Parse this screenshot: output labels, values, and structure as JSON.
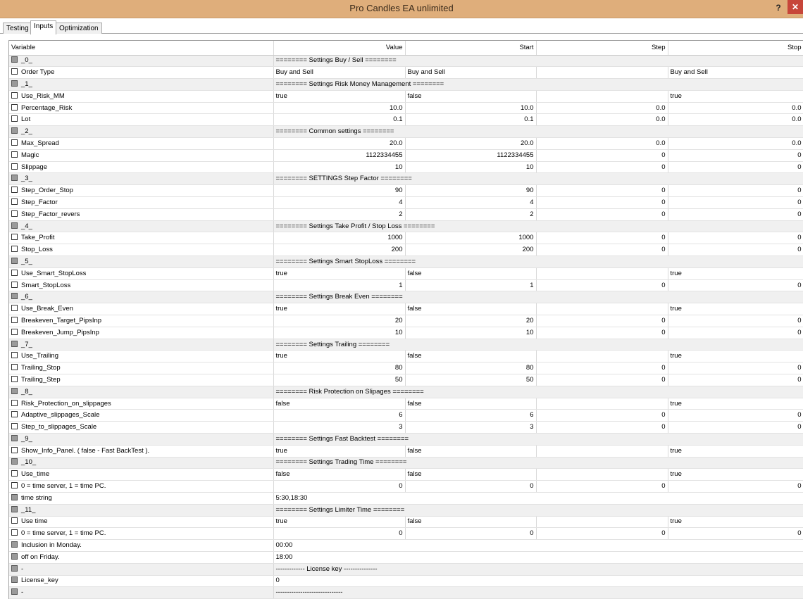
{
  "window": {
    "title": "Pro Candles EA unlimited",
    "help": "?",
    "close": "✕"
  },
  "tabs": [
    "Testing",
    "Inputs",
    "Optimization"
  ],
  "active_tab": "Inputs",
  "columns": [
    "Variable",
    "Value",
    "Start",
    "Step",
    "Stop"
  ],
  "rows": [
    {
      "kind": "group",
      "name": "_0_",
      "value": "======== Settings Buy / Sell ========"
    },
    {
      "kind": "row",
      "name": "Order Type",
      "value": "Buy and Sell",
      "start": "Buy and Sell",
      "step": "",
      "stop": "Buy and Sell",
      "text": true
    },
    {
      "kind": "group",
      "name": "_1_",
      "value": "======== Settings Risk Money Management ========"
    },
    {
      "kind": "row",
      "name": "Use_Risk_MM",
      "value": "true",
      "start": "false",
      "step": "",
      "stop": "true",
      "text": true
    },
    {
      "kind": "row",
      "name": "Percentage_Risk",
      "value": "10.0",
      "start": "10.0",
      "step": "0.0",
      "stop": "0.0"
    },
    {
      "kind": "row",
      "name": "Lot",
      "value": "0.1",
      "start": "0.1",
      "step": "0.0",
      "stop": "0.0"
    },
    {
      "kind": "group",
      "name": "_2_",
      "value": "======== Common settings ========"
    },
    {
      "kind": "row",
      "name": "Max_Spread",
      "value": "20.0",
      "start": "20.0",
      "step": "0.0",
      "stop": "0.0"
    },
    {
      "kind": "row",
      "name": "Magic",
      "value": "1122334455",
      "start": "1122334455",
      "step": "0",
      "stop": "0"
    },
    {
      "kind": "row",
      "name": "Slippage",
      "value": "10",
      "start": "10",
      "step": "0",
      "stop": "0"
    },
    {
      "kind": "group",
      "name": "_3_",
      "value": "======== SETTINGS Step Factor ========"
    },
    {
      "kind": "row",
      "name": "Step_Order_Stop",
      "value": "90",
      "start": "90",
      "step": "0",
      "stop": "0"
    },
    {
      "kind": "row",
      "name": "Step_Factor",
      "value": "4",
      "start": "4",
      "step": "0",
      "stop": "0"
    },
    {
      "kind": "row",
      "name": "Step_Factor_revers",
      "value": "2",
      "start": "2",
      "step": "0",
      "stop": "0"
    },
    {
      "kind": "group",
      "name": "_4_",
      "value": "======== Settings Take Profit / Stop Loss ========"
    },
    {
      "kind": "row",
      "name": "Take_Profit",
      "value": "1000",
      "start": "1000",
      "step": "0",
      "stop": "0"
    },
    {
      "kind": "row",
      "name": "Stop_Loss",
      "value": "200",
      "start": "200",
      "step": "0",
      "stop": "0"
    },
    {
      "kind": "group",
      "name": "_5_",
      "value": "======== Settings Smart StopLoss ========"
    },
    {
      "kind": "row",
      "name": "Use_Smart_StopLoss",
      "value": "true",
      "start": "false",
      "step": "",
      "stop": "true",
      "text": true
    },
    {
      "kind": "row",
      "name": "Smart_StopLoss",
      "value": "1",
      "start": "1",
      "step": "0",
      "stop": "0"
    },
    {
      "kind": "group",
      "name": "_6_",
      "value": "======== Settings Break Even  ========"
    },
    {
      "kind": "row",
      "name": "Use_Break_Even",
      "value": "true",
      "start": "false",
      "step": "",
      "stop": "true",
      "text": true
    },
    {
      "kind": "row",
      "name": "Breakeven_Target_PipsInp",
      "value": "20",
      "start": "20",
      "step": "0",
      "stop": "0"
    },
    {
      "kind": "row",
      "name": "Breakeven_Jump_PipsInp",
      "value": "10",
      "start": "10",
      "step": "0",
      "stop": "0"
    },
    {
      "kind": "group",
      "name": "_7_",
      "value": "======== Settings Trailing  ========"
    },
    {
      "kind": "row",
      "name": "Use_Trailing",
      "value": "true",
      "start": "false",
      "step": "",
      "stop": "true",
      "text": true
    },
    {
      "kind": "row",
      "name": "Trailing_Stop",
      "value": "80",
      "start": "80",
      "step": "0",
      "stop": "0"
    },
    {
      "kind": "row",
      "name": "Trailing_Step",
      "value": "50",
      "start": "50",
      "step": "0",
      "stop": "0"
    },
    {
      "kind": "group",
      "name": "_8_",
      "value": "======== Risk Protection on Slipages ========"
    },
    {
      "kind": "row",
      "name": "Risk_Protection_on_slippages",
      "value": "false",
      "start": "false",
      "step": "",
      "stop": "true",
      "text": true
    },
    {
      "kind": "row",
      "name": "Adaptive_slippages_Scale",
      "value": "6",
      "start": "6",
      "step": "0",
      "stop": "0"
    },
    {
      "kind": "row",
      "name": "Step_to_slippages_Scale",
      "value": "3",
      "start": "3",
      "step": "0",
      "stop": "0"
    },
    {
      "kind": "group",
      "name": "_9_",
      "value": "======== Settings Fast Backtest ========"
    },
    {
      "kind": "row",
      "name": "Show_Info_Panel. ( false - Fast BackTest ).",
      "value": "true",
      "start": "false",
      "step": "",
      "stop": "true",
      "text": true
    },
    {
      "kind": "group",
      "name": "_10_",
      "value": "======== Settings Trading Time ========"
    },
    {
      "kind": "row",
      "name": "Use_time",
      "value": "false",
      "start": "false",
      "step": "",
      "stop": "true",
      "text": true
    },
    {
      "kind": "row",
      "name": "0 = time server, 1 = time PC.",
      "value": "0",
      "start": "0",
      "step": "0",
      "stop": "0"
    },
    {
      "kind": "plain",
      "name": "time string",
      "value": "5:30,18:30"
    },
    {
      "kind": "group",
      "name": "_11_",
      "value": "======== Settings Limiter Time ========"
    },
    {
      "kind": "row",
      "name": "Use time",
      "value": "true",
      "start": "false",
      "step": "",
      "stop": "true",
      "text": true
    },
    {
      "kind": "row",
      "name": "0 = time server, 1 = time PC.",
      "value": "0",
      "start": "0",
      "step": "0",
      "stop": "0"
    },
    {
      "kind": "plain",
      "name": "Inclusion in Monday.",
      "value": "00:00"
    },
    {
      "kind": "plain",
      "name": "off on Friday.",
      "value": "18:00"
    },
    {
      "kind": "group",
      "name": "-",
      "value": "------------- License key ---------------"
    },
    {
      "kind": "plain",
      "name": "License_key",
      "value": "0"
    },
    {
      "kind": "group",
      "name": "-",
      "value": "------------------------------"
    }
  ]
}
